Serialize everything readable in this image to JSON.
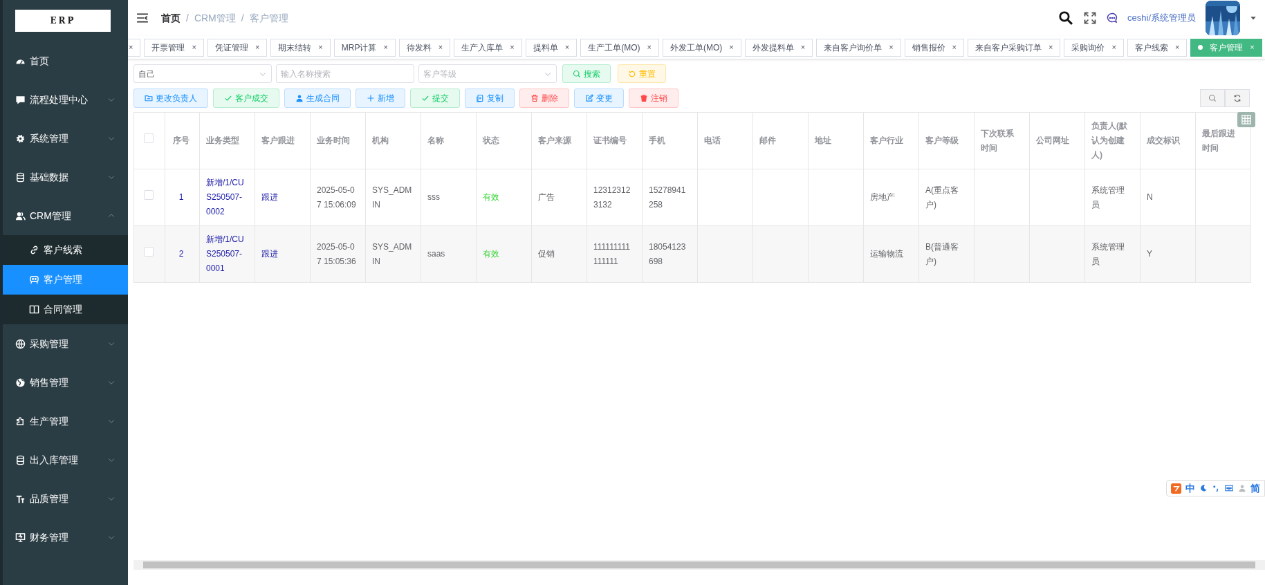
{
  "sidebar": {
    "logo": "ERP",
    "items": [
      {
        "label": "首页",
        "kind": "dashboard",
        "selected": false
      },
      {
        "label": "流程处理中心",
        "kind": "chat",
        "expanded": false,
        "selected": false
      },
      {
        "label": "系统管理",
        "kind": "gear",
        "expanded": false,
        "selected": false
      },
      {
        "label": "基础数据",
        "kind": "database",
        "expanded": false,
        "selected": false
      },
      {
        "label": "CRM管理",
        "kind": "users",
        "expanded": true,
        "selected": false,
        "children": [
          {
            "label": "客户线索",
            "kind": "link",
            "selected": false
          },
          {
            "label": "客户管理",
            "kind": "robot",
            "selected": true
          },
          {
            "label": "合同管理",
            "kind": "book",
            "selected": false
          }
        ]
      },
      {
        "label": "采购管理",
        "kind": "globe",
        "expanded": false,
        "selected": false
      },
      {
        "label": "销售管理",
        "kind": "earth",
        "expanded": false,
        "selected": false
      },
      {
        "label": "生产管理",
        "kind": "puzzle",
        "expanded": false,
        "selected": false
      },
      {
        "label": "出入库管理",
        "kind": "database",
        "expanded": false,
        "selected": false
      },
      {
        "label": "品质管理",
        "kind": "text",
        "expanded": false,
        "selected": false
      },
      {
        "label": "财务管理",
        "kind": "monitor",
        "expanded": false,
        "selected": false
      }
    ]
  },
  "breadcrumb": [
    {
      "label": "首页",
      "selected": true
    },
    {
      "label": "CRM管理",
      "selected": false
    },
    {
      "label": "客户管理",
      "selected": false
    }
  ],
  "breadcrumb_separator": "/",
  "user": {
    "name": "ceshi/系统管理员"
  },
  "tabs": [
    {
      "close": "×",
      "selected": false
    },
    {
      "label": "开票管理",
      "close": "×",
      "selected": false
    },
    {
      "label": "凭证管理",
      "close": "×",
      "selected": false
    },
    {
      "label": "期末结转",
      "close": "×",
      "selected": false
    },
    {
      "label": "MRP计算",
      "close": "×",
      "selected": false
    },
    {
      "label": "待发料",
      "close": "×",
      "selected": false
    },
    {
      "label": "生产入库单",
      "close": "×",
      "selected": false
    },
    {
      "label": "提料单",
      "close": "×",
      "selected": false
    },
    {
      "label": "生产工单(MO)",
      "close": "×",
      "selected": false
    },
    {
      "label": "外发工单(MO)",
      "close": "×",
      "selected": false
    },
    {
      "label": "外发提料单",
      "close": "×",
      "selected": false
    },
    {
      "label": "来自客户询价单",
      "close": "×",
      "selected": false
    },
    {
      "label": "销售报价",
      "close": "×",
      "selected": false
    },
    {
      "label": "来自客户采购订单",
      "close": "×",
      "selected": false
    },
    {
      "label": "采购询价",
      "close": "×",
      "selected": false
    },
    {
      "label": "客户线索",
      "close": "×",
      "selected": false
    },
    {
      "label": "客户管理",
      "close": "×",
      "selected": true
    }
  ],
  "filters": {
    "owner": {
      "value": "自己"
    },
    "name": {
      "placeholder": "输入名称搜索"
    },
    "level": {
      "placeholder": "客户等级"
    },
    "search_button": "搜索",
    "reset_button": "重置"
  },
  "actions": [
    {
      "label": "更改负责人",
      "kind": "folder"
    },
    {
      "label": "客户成交",
      "kind": "check"
    },
    {
      "label": "生成合同",
      "kind": "user"
    },
    {
      "label": "新增",
      "kind": "plus"
    },
    {
      "label": "提交",
      "kind": "check"
    },
    {
      "label": "复制",
      "kind": "copy"
    },
    {
      "label": "删除",
      "kind": "trash"
    },
    {
      "label": "变更",
      "kind": "edit"
    },
    {
      "label": "注销",
      "kind": "revoke"
    }
  ],
  "table": {
    "all_selected": false,
    "columns": [
      {
        "label": "序号",
        "kind": "index"
      },
      {
        "label": "业务类型",
        "kind": "link"
      },
      {
        "label": "客户跟进",
        "kind": "link"
      },
      {
        "label": "业务时间",
        "kind": "text"
      },
      {
        "label": "机构",
        "kind": "text"
      },
      {
        "label": "名称",
        "kind": "text"
      },
      {
        "label": "状态",
        "kind": "status"
      },
      {
        "label": "客户来源",
        "kind": "text"
      },
      {
        "label": "证书编号",
        "kind": "text"
      },
      {
        "label": "手机",
        "kind": "text"
      },
      {
        "label": "电话",
        "kind": "text"
      },
      {
        "label": "邮件",
        "kind": "text"
      },
      {
        "label": "地址",
        "kind": "text"
      },
      {
        "label": "客户行业",
        "kind": "text"
      },
      {
        "label": "客户等级",
        "kind": "text"
      },
      {
        "label": "下次联系时间",
        "kind": "text"
      },
      {
        "label": "公司网址",
        "kind": "text"
      },
      {
        "label": "负责人(默认为创建人)",
        "kind": "text"
      },
      {
        "label": "成交标识",
        "kind": "text"
      },
      {
        "label": "最后跟进时间",
        "kind": "text"
      }
    ],
    "rows": [
      {
        "selected": false,
        "cells": [
          "1",
          "新增/1/CUS250507-0002",
          "跟进",
          "2025-05-07 15:06:09",
          "SYS_ADMIN",
          "sss",
          "有效",
          "广告",
          "123123123132",
          "15278941258",
          null,
          null,
          null,
          "房地产",
          "A(重点客户)",
          null,
          null,
          "系统管理员",
          "N",
          null
        ]
      },
      {
        "selected": false,
        "cells": [
          "2",
          "新增/1/CUS250507-0001",
          "跟进",
          "2025-05-07 15:05:36",
          "SYS_ADMIN",
          "saas",
          "有效",
          "促销",
          "111111111111111",
          "18054123698",
          null,
          null,
          null,
          "运输物流",
          "B(普通客户)",
          null,
          null,
          "系统管理员",
          "Y",
          null
        ]
      }
    ]
  },
  "ime_toolbar": {
    "items": [
      "中",
      "简"
    ]
  }
}
